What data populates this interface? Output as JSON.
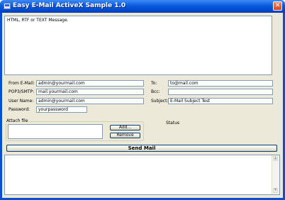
{
  "window": {
    "title": "Easy E-Mail ActiveX Sample 1.0",
    "close_glyph": "✕"
  },
  "message": {
    "placeholder": "HTML, RTF or TEXT Message."
  },
  "form": {
    "from_label": "From E-Mail:",
    "from_value": "admin@yourmail.com",
    "pop_label": "POP3/SMTP:",
    "pop_value": "mail.yourmail.com",
    "user_label": "User Name:",
    "user_value": "admin@yourmail.com",
    "password_label": "Password:",
    "password_value": "yourpassword",
    "to_label": "To:",
    "to_value": "to@mail.com",
    "bcc_label": "Bcc:",
    "bcc_value": "",
    "subject_label": "Subject:",
    "subject_value": "E-Mail Subject Test"
  },
  "attach": {
    "legend": "Attach file",
    "add_label": "Add...",
    "remove_label": "Remove"
  },
  "status": {
    "label": "Status"
  },
  "send": {
    "label": "Send Mail"
  },
  "log": {
    "up_glyph": "▲",
    "down_glyph": "▼"
  },
  "icons": {
    "app": "envelope-app-icon",
    "close": "close-icon"
  },
  "colors": {
    "titlebar": "#0a5ae0",
    "client": "#ece9d8",
    "close": "#d4442a"
  }
}
